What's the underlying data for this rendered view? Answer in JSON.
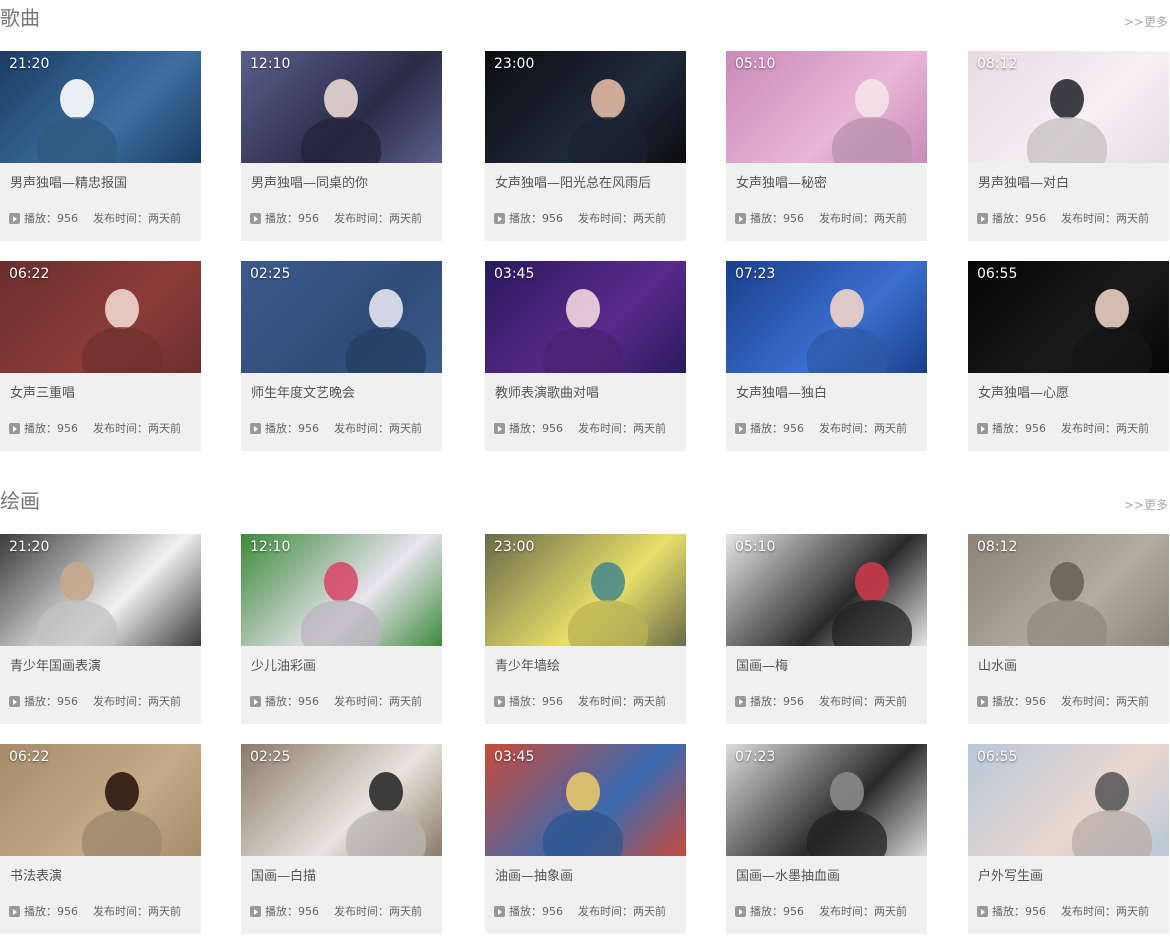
{
  "sections": [
    {
      "title": "歌曲",
      "more": ">>更多",
      "items": [
        {
          "duration": "21:20",
          "title": "男声独唱—精忠报国",
          "play_label": "播放：956",
          "date_label": "发布时间：两天前",
          "colors": [
            "#1b3c63",
            "#3d6fa0",
            "#ffffff"
          ]
        },
        {
          "duration": "12:10",
          "title": "男声独唱—同桌的你",
          "play_label": "播放：956",
          "date_label": "发布时间：两天前",
          "colors": [
            "#5b5f8c",
            "#2a2c48",
            "#e8d8d0"
          ]
        },
        {
          "duration": "23:00",
          "title": "女声独唱—阳光总在风雨后",
          "play_label": "播放：956",
          "date_label": "发布时间：两天前",
          "colors": [
            "#0c0c10",
            "#1f2a3a",
            "#e2b9a3"
          ]
        },
        {
          "duration": "05:10",
          "title": "女声独唱—秘密",
          "play_label": "播放：956",
          "date_label": "发布时间：两天前",
          "colors": [
            "#c98ab9",
            "#e9b6d6",
            "#f4e2e6"
          ]
        },
        {
          "duration": "08:12",
          "title": "男声独唱—对白",
          "play_label": "播放：956",
          "date_label": "发布时间：两天前",
          "colors": [
            "#e7dbe2",
            "#f6f0f3",
            "#2a2a30"
          ]
        },
        {
          "duration": "06:22",
          "title": "女声三重唱",
          "play_label": "播放：956",
          "date_label": "发布时间：两天前",
          "colors": [
            "#6a2e2e",
            "#8c3c38",
            "#f0d6d0"
          ]
        },
        {
          "duration": "02:25",
          "title": "师生年度文艺晚会",
          "play_label": "播放：956",
          "date_label": "发布时间：两天前",
          "colors": [
            "#3c5a8e",
            "#2f4c78",
            "#e6e6ee"
          ]
        },
        {
          "duration": "03:45",
          "title": "教师表演歌曲对唱",
          "play_label": "播放：956",
          "date_label": "发布时间：两天前",
          "colors": [
            "#2a1a5c",
            "#5a2a8c",
            "#f0d6e0"
          ]
        },
        {
          "duration": "07:23",
          "title": "女声独唱—独白",
          "play_label": "播放：956",
          "date_label": "发布时间：两天前",
          "colors": [
            "#1a3f8a",
            "#3a6fd0",
            "#f0d4c6"
          ]
        },
        {
          "duration": "06:55",
          "title": "女声独唱—心愿",
          "play_label": "播放：956",
          "date_label": "发布时间：两天前",
          "colors": [
            "#050505",
            "#1a1a1a",
            "#e8cfc2"
          ]
        }
      ]
    },
    {
      "title": "绘画",
      "more": ">>更多",
      "items": [
        {
          "duration": "21:20",
          "title": "青少年国画表演",
          "play_label": "播放：956",
          "date_label": "发布时间：两天前",
          "colors": [
            "#3a3a3a",
            "#f2f2f2",
            "#c8a88c"
          ]
        },
        {
          "duration": "12:10",
          "title": "少儿油彩画",
          "play_label": "播放：956",
          "date_label": "发布时间：两天前",
          "colors": [
            "#3c8a3a",
            "#e9e4ee",
            "#d64a6a"
          ]
        },
        {
          "duration": "23:00",
          "title": "青少年墙绘",
          "play_label": "播放：956",
          "date_label": "发布时间：两天前",
          "colors": [
            "#6a6a4a",
            "#e8e06a",
            "#4a8a8a"
          ]
        },
        {
          "duration": "05:10",
          "title": "国画—梅",
          "play_label": "播放：956",
          "date_label": "发布时间：两天前",
          "colors": [
            "#e6e6e6",
            "#2a2a2a",
            "#c83a4a"
          ]
        },
        {
          "duration": "08:12",
          "title": "山水画",
          "play_label": "播放：956",
          "date_label": "发布时间：两天前",
          "colors": [
            "#8c8278",
            "#b4aca0",
            "#6a6258"
          ]
        },
        {
          "duration": "06:22",
          "title": "书法表演",
          "play_label": "播放：956",
          "date_label": "发布时间：两天前",
          "colors": [
            "#a68c6a",
            "#c4aa88",
            "#2a1a10"
          ]
        },
        {
          "duration": "02:25",
          "title": "国画—白描",
          "play_label": "播放：956",
          "date_label": "发布时间：两天前",
          "colors": [
            "#8a7a68",
            "#e8e4de",
            "#2a2a2a"
          ]
        },
        {
          "duration": "03:45",
          "title": "油画—抽象画",
          "play_label": "播放：956",
          "date_label": "发布时间：两天前",
          "colors": [
            "#c84a3a",
            "#3a6ab0",
            "#e8c86a"
          ]
        },
        {
          "duration": "07:23",
          "title": "国画—水墨抽血画",
          "play_label": "播放：956",
          "date_label": "发布时间：两天前",
          "colors": [
            "#dcdcdc",
            "#2a2a2a",
            "#8a8a8a"
          ]
        },
        {
          "duration": "06:55",
          "title": "户外写生画",
          "play_label": "播放：956",
          "date_label": "发布时间：两天前",
          "colors": [
            "#b8c8d8",
            "#e8d8d0",
            "#5a5a5a"
          ]
        }
      ]
    }
  ]
}
